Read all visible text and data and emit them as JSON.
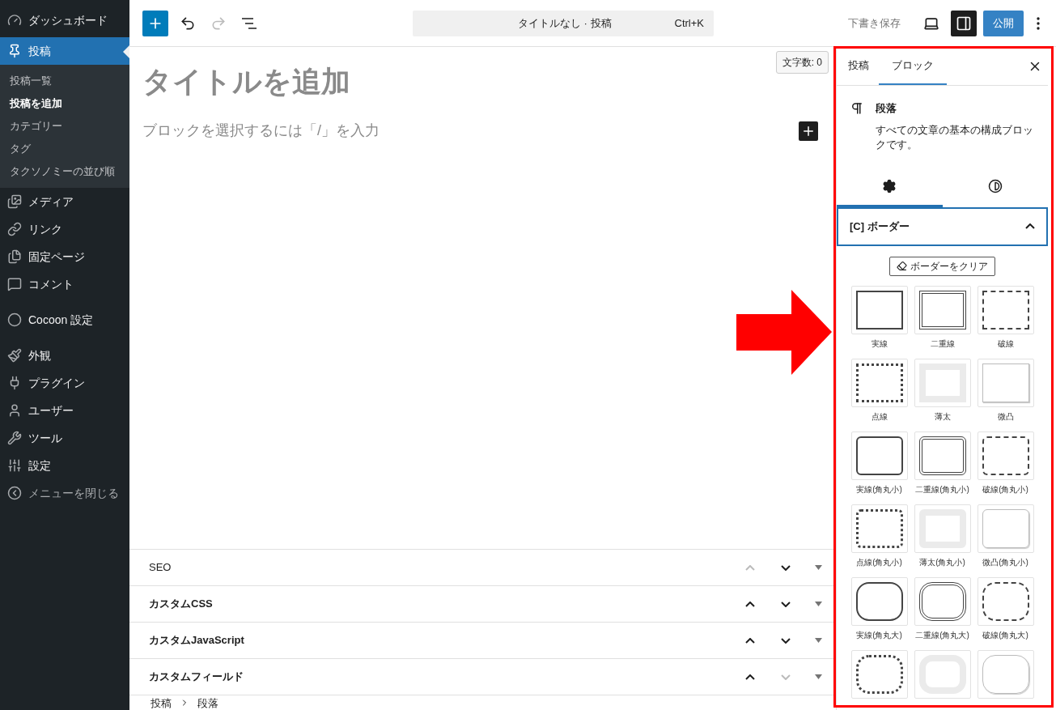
{
  "sidebar": {
    "groups": [
      {
        "items": [
          {
            "kind": "menu",
            "label": "ダッシュボード",
            "selected": false
          },
          {
            "kind": "menu",
            "label": "投稿",
            "selected": true,
            "submenu": [
              {
                "label": "投稿一覧",
                "selected": false
              },
              {
                "label": "投稿を追加",
                "selected": true
              },
              {
                "label": "カテゴリー",
                "selected": false
              },
              {
                "label": "タグ",
                "selected": false
              },
              {
                "label": "タクソノミーの並び順",
                "selected": false
              }
            ]
          },
          {
            "kind": "menu",
            "label": "メディア",
            "selected": false
          },
          {
            "kind": "menu",
            "label": "リンク",
            "selected": false
          },
          {
            "kind": "menu",
            "label": "固定ページ",
            "selected": false
          },
          {
            "kind": "menu",
            "label": "コメント",
            "selected": false
          }
        ]
      },
      {
        "items": [
          {
            "kind": "menu",
            "label": "Cocoon 設定",
            "selected": false
          }
        ]
      },
      {
        "items": [
          {
            "kind": "menu",
            "label": "外観",
            "selected": false
          },
          {
            "kind": "menu",
            "label": "プラグイン",
            "selected": false
          },
          {
            "kind": "menu",
            "label": "ユーザー",
            "selected": false
          },
          {
            "kind": "menu",
            "label": "ツール",
            "selected": false
          },
          {
            "kind": "menu",
            "label": "設定",
            "selected": false
          },
          {
            "kind": "collapse",
            "label": "メニューを閉じる",
            "selected": false
          }
        ]
      }
    ]
  },
  "toolbar": {
    "undo_disabled": false,
    "redo_disabled": true,
    "command": {
      "title": "タイトルなし · 投稿",
      "shortcut": "Ctrl+K"
    },
    "save_draft": "下書き保存",
    "sidebar_toggle_on": true,
    "publish": "公開"
  },
  "editor": {
    "char_count": "文字数: 0",
    "title_placeholder": "タイトルを追加",
    "block_placeholder": "ブロックを選択するには「/」を入力"
  },
  "meta_boxes": [
    {
      "title": "SEO",
      "up_disabled": true,
      "down_disabled": false
    },
    {
      "title": "カスタムCSS",
      "up_disabled": false,
      "down_disabled": false
    },
    {
      "title": "カスタムJavaScript",
      "up_disabled": false,
      "down_disabled": false
    },
    {
      "title": "カスタムフィールド",
      "up_disabled": false,
      "down_disabled": true
    }
  ],
  "breadcrumb": [
    "投稿",
    "段落"
  ],
  "inspector": {
    "tabs": [
      {
        "label": "投稿",
        "selected": false
      },
      {
        "label": "ブロック",
        "selected": true
      }
    ],
    "block": {
      "name": "段落",
      "description": "すべての文章の基本の構成ブロックです。"
    },
    "subtabs": [
      {
        "kind": "settings",
        "selected": true
      },
      {
        "kind": "styles",
        "selected": false
      }
    ],
    "panel": {
      "title": "[C] ボーダー",
      "expanded": true,
      "clear_button": "ボーダーをクリア",
      "style_groups": [
        {
          "kind": "square",
          "styles": [
            {
              "kind": "solid",
              "label": "実線"
            },
            {
              "kind": "double",
              "label": "二重線"
            },
            {
              "kind": "dashed",
              "label": "破線"
            },
            {
              "kind": "dotted",
              "label": "点線"
            },
            {
              "kind": "thick",
              "label": "薄太"
            },
            {
              "kind": "inset",
              "label": "微凸"
            }
          ]
        },
        {
          "kind": "small",
          "styles": [
            {
              "kind": "solid",
              "label": "実線(角丸小)"
            },
            {
              "kind": "double",
              "label": "二重線(角丸小)"
            },
            {
              "kind": "dashed",
              "label": "破線(角丸小)"
            },
            {
              "kind": "dotted",
              "label": "点線(角丸小)"
            },
            {
              "kind": "thick",
              "label": "薄太(角丸小)"
            },
            {
              "kind": "inset",
              "label": "微凸(角丸小)"
            }
          ]
        },
        {
          "kind": "large",
          "styles": [
            {
              "kind": "solid",
              "label": "実線(角丸大)"
            },
            {
              "kind": "double",
              "label": "二重線(角丸大)"
            },
            {
              "kind": "dashed",
              "label": "破線(角丸大)"
            },
            {
              "kind": "dotted"
            },
            {
              "kind": "thick"
            },
            {
              "kind": "inset"
            }
          ]
        }
      ]
    }
  },
  "annotation": {
    "highlight_frame": true,
    "arrow": true
  }
}
